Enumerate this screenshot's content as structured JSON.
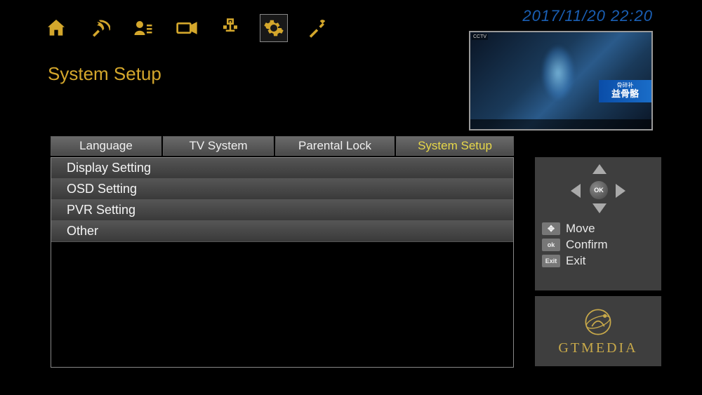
{
  "datetime": "2017/11/20  22:20",
  "page_title": "System Setup",
  "nav_icons": [
    {
      "name": "home-icon"
    },
    {
      "name": "satellite-icon"
    },
    {
      "name": "user-icon"
    },
    {
      "name": "video-icon"
    },
    {
      "name": "network-icon"
    },
    {
      "name": "settings-icon",
      "selected": true
    },
    {
      "name": "tools-icon"
    }
  ],
  "tabs": [
    {
      "label": "Language",
      "active": false
    },
    {
      "label": "TV System",
      "active": false
    },
    {
      "label": "Parental Lock",
      "active": false
    },
    {
      "label": "System Setup",
      "active": true
    }
  ],
  "list_items": [
    "Display Setting",
    "OSD Setting",
    "PVR Setting",
    "Other"
  ],
  "hints": {
    "move": "Move",
    "confirm": "Confirm",
    "exit": "Exit",
    "ok_label": "ok",
    "exit_label": "Exit"
  },
  "brand": "GTMEDIA",
  "pip": {
    "channel_tag": "CCTV",
    "banner_top": "骨碎补",
    "banner_main": "益骨骼"
  }
}
